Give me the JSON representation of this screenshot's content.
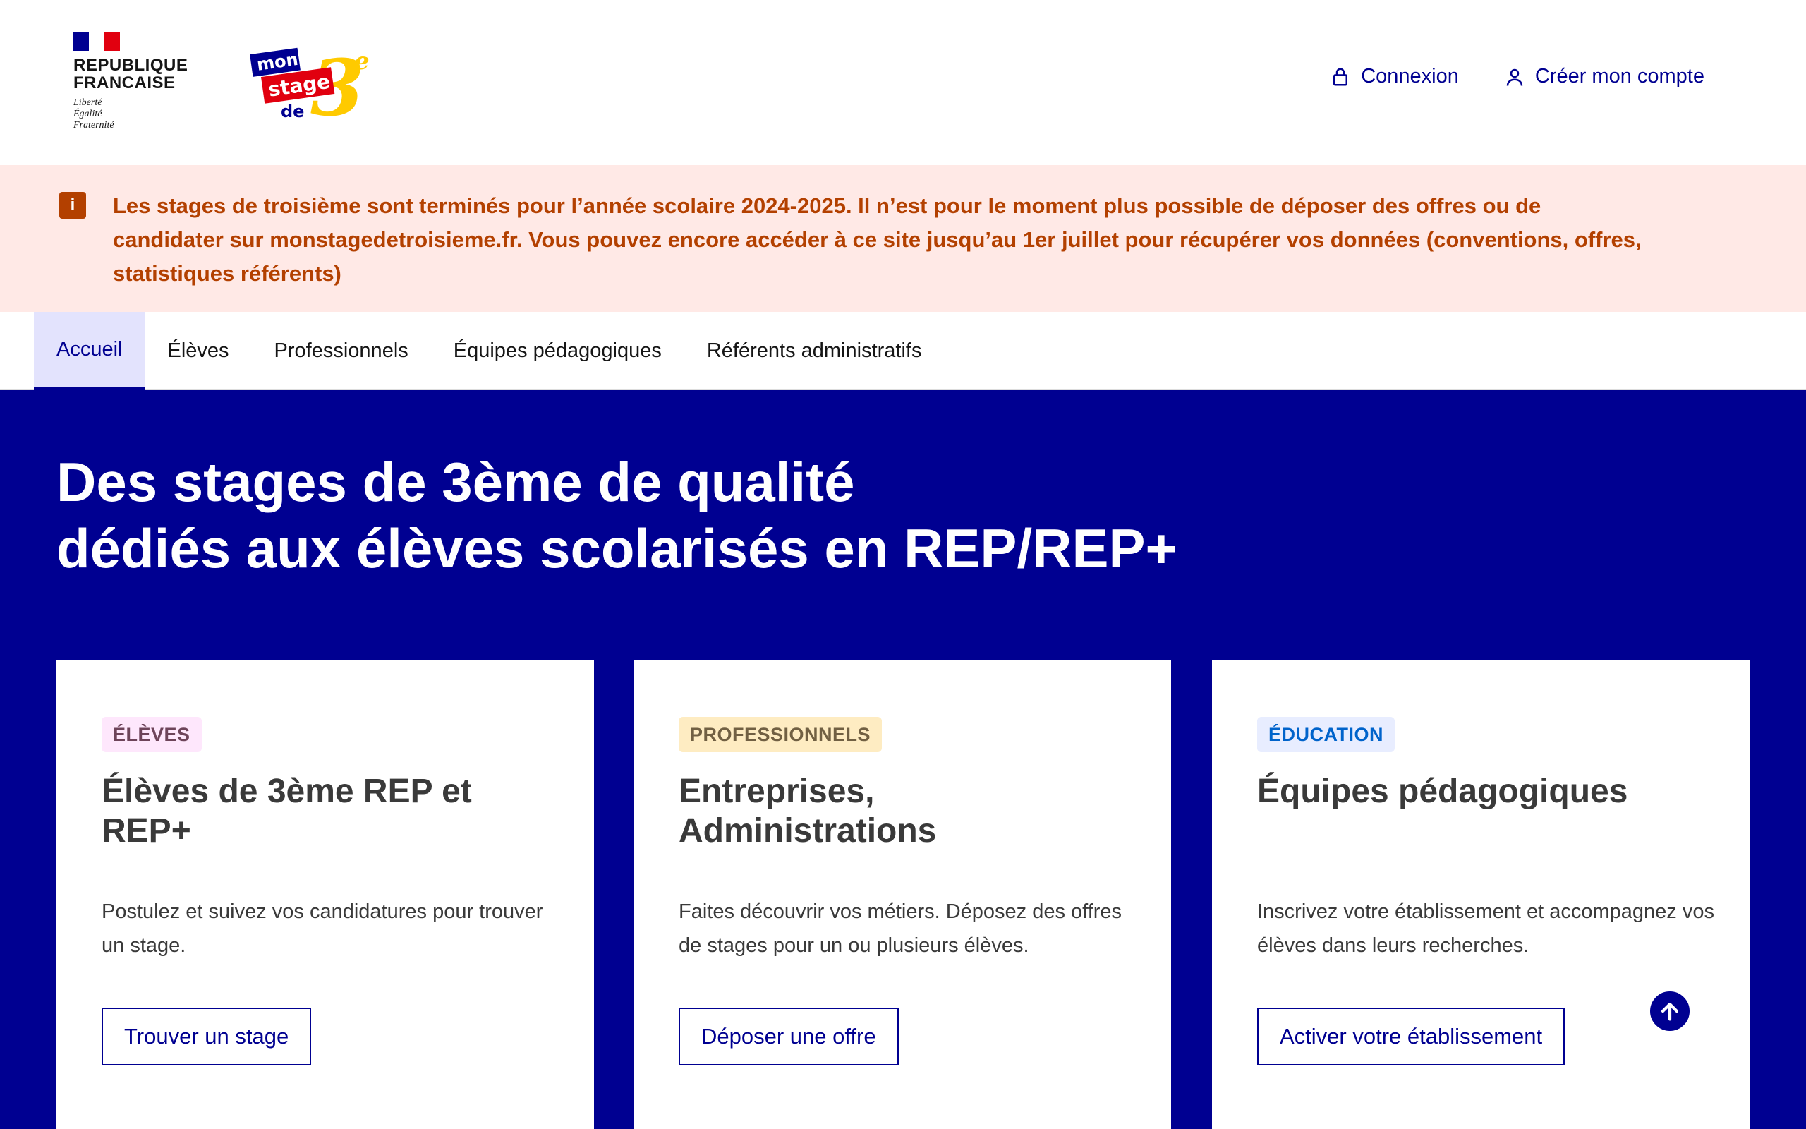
{
  "brand": {
    "republique_line1": "REPUBLIQUE",
    "republique_line2": "FRANCAISE",
    "devise": [
      "Liberté",
      "Égalité",
      "Fraternité"
    ],
    "logo_words": [
      "mon",
      "stage",
      "de",
      "3",
      "e"
    ]
  },
  "header": {
    "login_label": "Connexion",
    "signup_label": "Créer mon compte"
  },
  "notice": {
    "icon": "info-icon",
    "text": "Les stages de troisième sont terminés pour l’année scolaire 2024-2025. Il n’est pour le moment plus possible de déposer des offres ou de candidater sur monstagedetroisieme.fr. Vous pouvez encore accéder à ce site jusqu’au 1er juillet pour récupérer vos données (conventions, offres, statistiques référents)"
  },
  "nav": {
    "items": [
      {
        "label": "Accueil",
        "active": true
      },
      {
        "label": "Élèves",
        "active": false
      },
      {
        "label": "Professionnels",
        "active": false
      },
      {
        "label": "Équipes pédagogiques",
        "active": false
      },
      {
        "label": "Référents administratifs",
        "active": false
      }
    ]
  },
  "hero": {
    "title_line1": "Des stages de 3ème de qualité",
    "title_line2": "dédiés aux élèves scolarisés en REP/REP+"
  },
  "cards": [
    {
      "badge": "ÉLÈVES",
      "title": "Élèves de 3ème REP et REP+",
      "description": "Postulez et suivez vos candidatures pour trouver un stage.",
      "button": "Trouver un stage"
    },
    {
      "badge": "PROFESSIONNELS",
      "title": "Entreprises, Administrations",
      "description": "Faites découvrir vos métiers. Déposez des offres de stages pour un ou plusieurs élèves.",
      "button": "Déposer une offre"
    },
    {
      "badge": "ÉDUCATION",
      "title": "Équipes pédagogiques",
      "description": "Inscrivez votre établissement et accompagnez vos élèves dans leurs recherches.",
      "button": "Activer votre établissement"
    }
  ],
  "colors": {
    "primary": "#000091",
    "notice_bg": "#ffe9e6",
    "notice_text": "#b34000",
    "nav_active_bg": "#e3e3fd"
  }
}
